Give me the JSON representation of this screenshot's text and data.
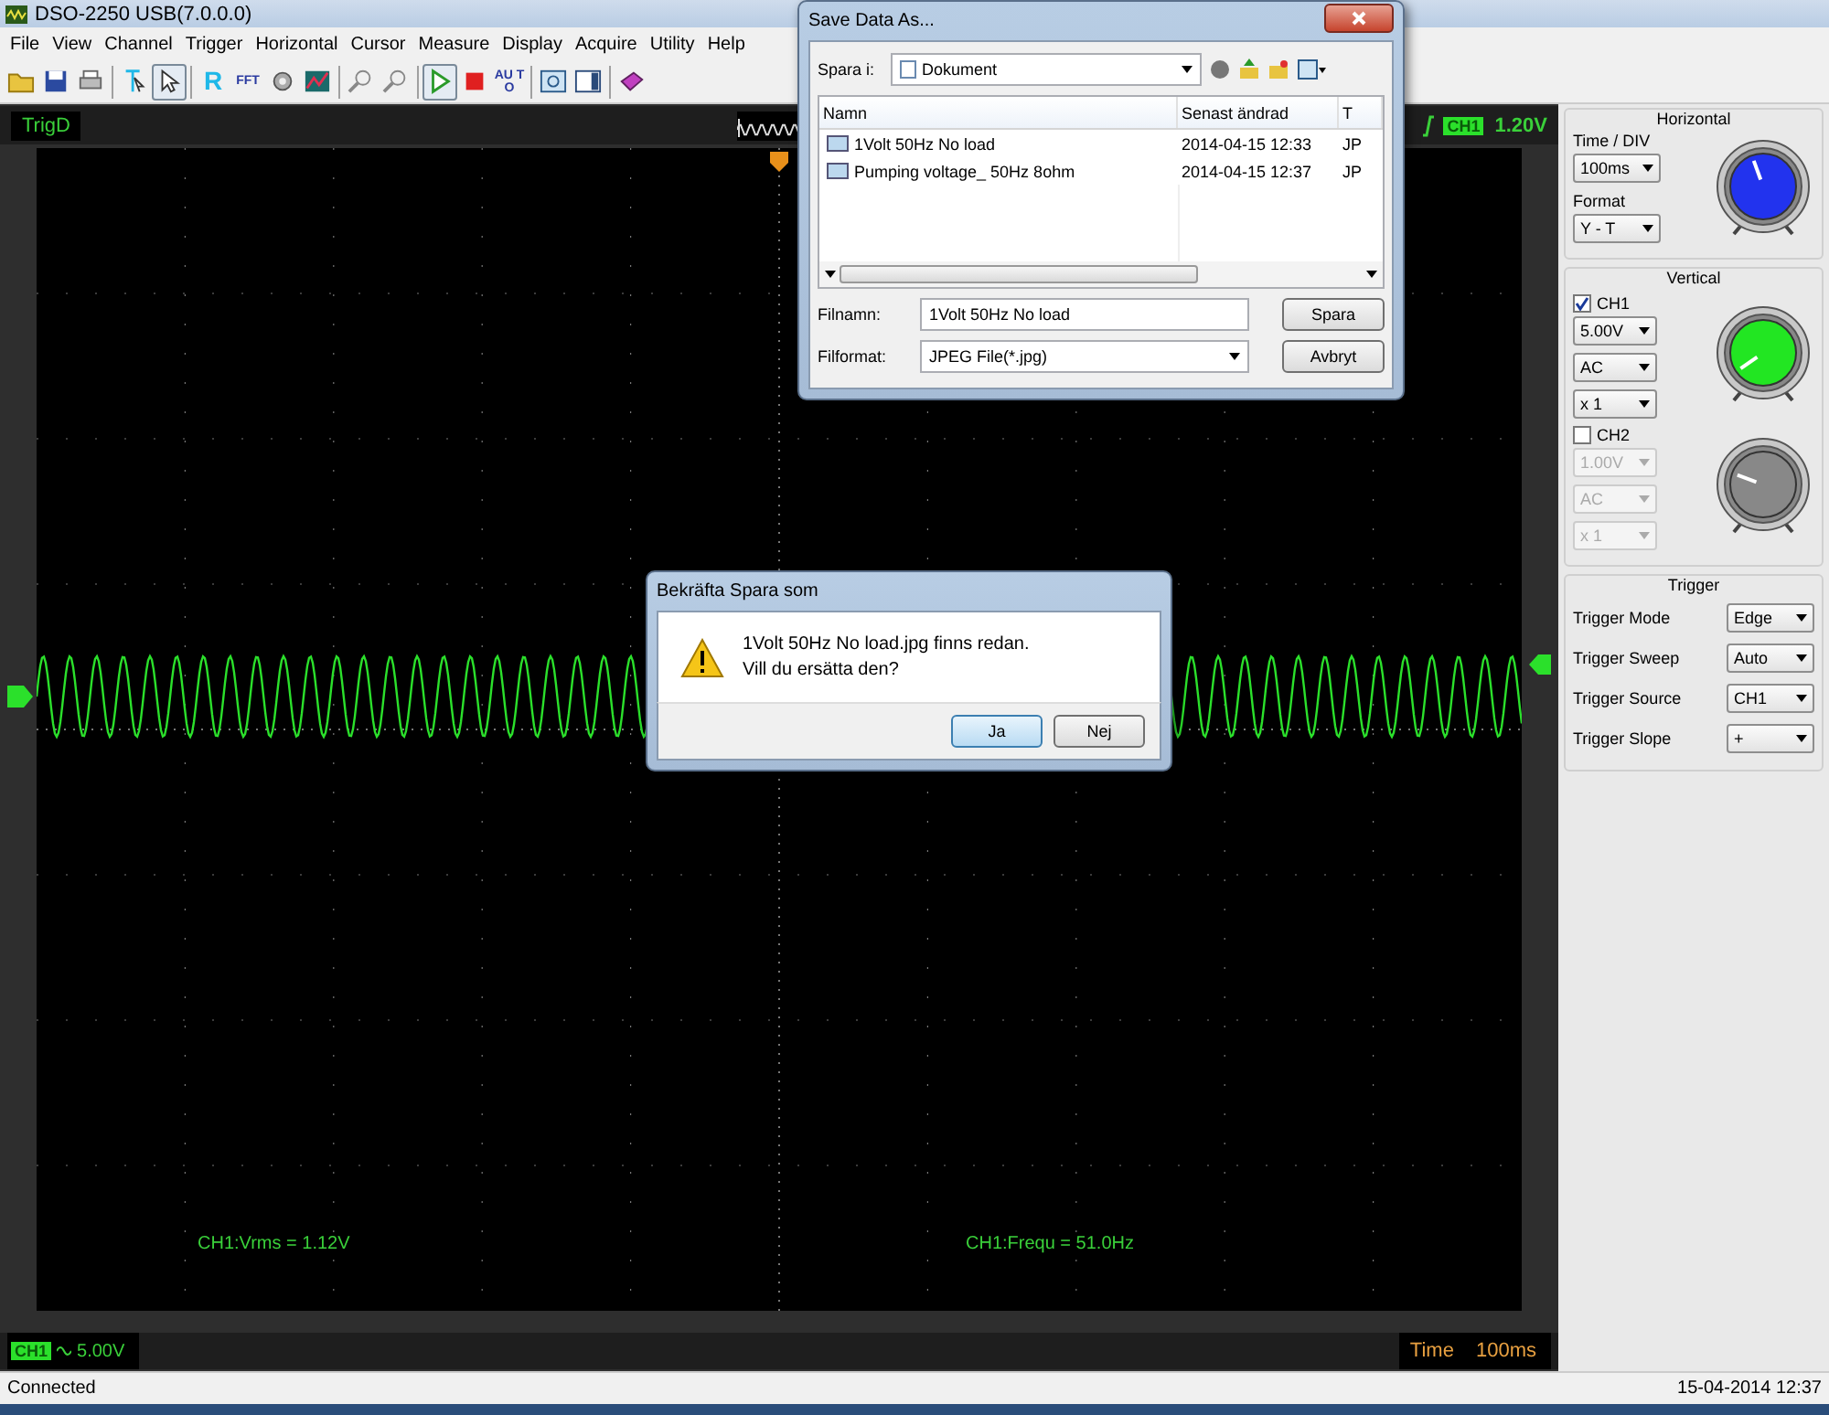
{
  "window": {
    "title": "DSO-2250 USB(7.0.0.0)"
  },
  "menu": [
    "File",
    "View",
    "Channel",
    "Trigger",
    "Horizontal",
    "Cursor",
    "Measure",
    "Display",
    "Acquire",
    "Utility",
    "Help"
  ],
  "toolbar": [
    {
      "kind": "icon",
      "selected": false
    },
    {
      "kind": "icon",
      "selected": false
    },
    {
      "kind": "icon",
      "selected": false
    },
    {
      "kind": "separator"
    },
    {
      "kind": "icon",
      "selected": false
    },
    {
      "kind": "icon",
      "selected": true
    },
    {
      "kind": "separator"
    },
    {
      "kind": "text",
      "label": "R",
      "selected": false
    },
    {
      "kind": "text",
      "label": "FFT",
      "selected": false
    },
    {
      "kind": "icon",
      "selected": false
    },
    {
      "kind": "icon",
      "selected": false
    },
    {
      "kind": "separator"
    },
    {
      "kind": "icon",
      "selected": false
    },
    {
      "kind": "icon",
      "selected": false
    },
    {
      "kind": "separator"
    },
    {
      "kind": "icon",
      "selected": true
    },
    {
      "kind": "icon",
      "selected": false
    },
    {
      "kind": "text",
      "label": "AU TO",
      "selected": false
    },
    {
      "kind": "separator"
    },
    {
      "kind": "icon",
      "selected": false
    },
    {
      "kind": "icon",
      "selected": false
    },
    {
      "kind": "separator"
    },
    {
      "kind": "icon",
      "selected": false
    }
  ],
  "scope": {
    "trigger_status": "TrigD",
    "trigger_channel": "CH1",
    "trigger_level": "1.20V",
    "measurements": [
      "CH1:Vrms = 1.12V",
      "CH1:Frequ = 51.0Hz"
    ],
    "channel_badge": "CH1",
    "channel_scale": "5.00V",
    "time_label": "Time",
    "time_value": "100ms"
  },
  "panel": {
    "horizontal": {
      "title": "Horizontal",
      "time_div_label": "Time / DIV",
      "time_div": "100ms",
      "format_label": "Format",
      "format": "Y - T"
    },
    "vertical": {
      "title": "Vertical",
      "channels": [
        {
          "label": "CH1",
          "checked": true,
          "scale": "5.00V",
          "coupling": "AC",
          "probe": "x 1"
        },
        {
          "label": "CH2",
          "checked": false,
          "scale": "1.00V",
          "coupling": "AC",
          "probe": "x 1"
        }
      ]
    },
    "trigger": {
      "title": "Trigger",
      "rows": [
        {
          "label": "Trigger Mode",
          "value": "Edge"
        },
        {
          "label": "Trigger Sweep",
          "value": "Auto"
        },
        {
          "label": "Trigger Source",
          "value": "CH1"
        },
        {
          "label": "Trigger Slope",
          "value": "+"
        }
      ]
    }
  },
  "status_bar": {
    "state": "Connected",
    "datetime": "15-04-2014 12:37"
  },
  "save_dialog": {
    "title": "Save Data As...",
    "location_label": "Spara i:",
    "location": "Dokument",
    "columns": [
      "Namn",
      "Senast ändrad",
      "T"
    ],
    "files": [
      {
        "name": "1Volt 50Hz No load",
        "modified": "2014-04-15 12:33",
        "type": "JP"
      },
      {
        "name": "Pumping voltage_ 50Hz  8ohm",
        "modified": "2014-04-15 12:37",
        "type": "JP"
      }
    ],
    "filename_label": "Filnamn:",
    "filename": "1Volt 50Hz No load",
    "format_label": "Filformat:",
    "format": "JPEG File(*.jpg)",
    "buttons": [
      "Spara",
      "Avbryt"
    ]
  },
  "confirm_dialog": {
    "title": "Bekräfta Spara som",
    "message": [
      "1Volt 50Hz No load.jpg finns redan.",
      "Vill du ersätta den?"
    ],
    "buttons": [
      {
        "label": "Ja",
        "selected": true
      },
      {
        "label": "Nej",
        "selected": false
      }
    ]
  }
}
